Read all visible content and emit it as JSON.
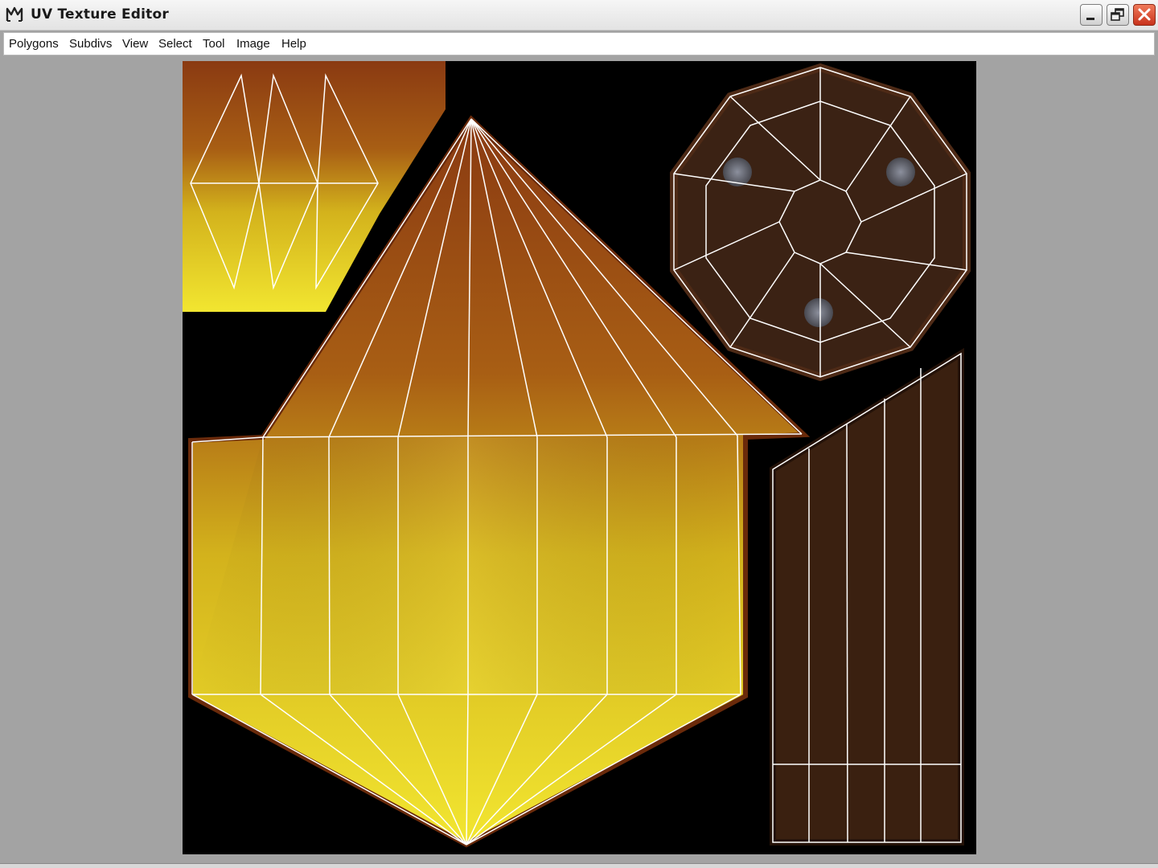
{
  "window": {
    "title": "UV Texture Editor",
    "icon": "maya-icon",
    "controls": [
      "minimize-icon",
      "restore-icon",
      "close-icon"
    ]
  },
  "menu": {
    "items": [
      "Polygons",
      "Subdivs",
      "View",
      "Select",
      "Tool",
      "Image",
      "Help"
    ]
  },
  "editor": {
    "background_color": "#a3a3a3",
    "texture_background": "#000000",
    "uv_wire_color": "#ffffff",
    "flame_colors": [
      "#f2e020",
      "#d9a21a",
      "#8a3a12"
    ],
    "wood_color": "#3a2010"
  }
}
